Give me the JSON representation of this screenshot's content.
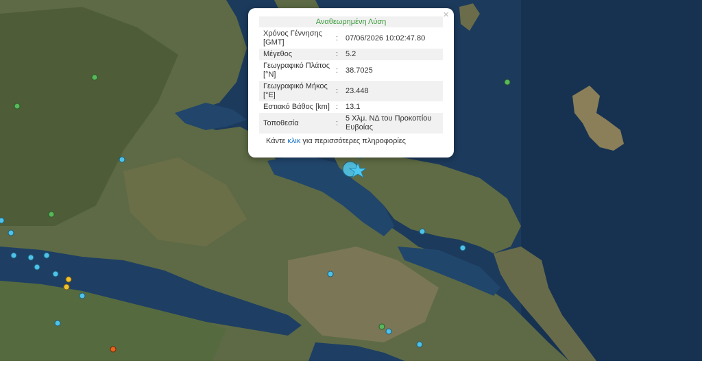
{
  "popup": {
    "title": "Αναθεωρημένη Λύση",
    "close_glyph": "×",
    "rows": [
      {
        "label": "Χρόνος Γέννησης [GMT]",
        "sep": ":",
        "value": "07/06/2026 10:02:47.80"
      },
      {
        "label": "Μέγεθος",
        "sep": ":",
        "value": "5.2"
      },
      {
        "label": "Γεωγραφικό Πλάτος [°N]",
        "sep": ":",
        "value": "38.7025"
      },
      {
        "label": "Γεωγραφικό Μήκος [°E]",
        "sep": ":",
        "value": "23.448"
      },
      {
        "label": "Εστιακό Βάθος [km]",
        "sep": ":",
        "value": "13.1"
      },
      {
        "label": "Τοποθεσία",
        "sep": ":",
        "value": "5 Χλμ. ΝΔ του Προκοπίου Ευβοίας"
      }
    ],
    "more_prefix": "Κάντε ",
    "more_link": "κλικ",
    "more_suffix": " για περισσότερες πληροφορίες"
  },
  "colors": {
    "sea": "#1c3a5c",
    "land": "#5e6b47",
    "marker_cyan": "#4ec2e8",
    "marker_green": "#59b85a",
    "marker_yellow": "#f2c12e",
    "marker_orange": "#e8631c",
    "star": "#4fc8f0",
    "link": "#1a73c8",
    "title_green": "#3a9a3a"
  },
  "icons": {
    "epicenter": "star-icon",
    "close": "close-icon"
  }
}
